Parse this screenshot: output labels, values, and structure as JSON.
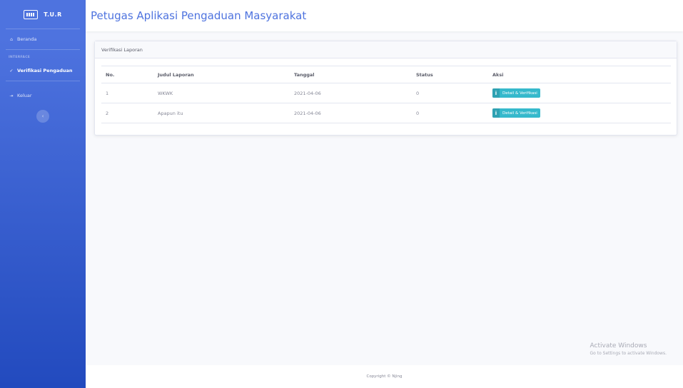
{
  "brand": {
    "name": "T.U.R",
    "icon": "keyboard-icon"
  },
  "sidebar": {
    "items": [
      {
        "label": "Beranda",
        "icon": "home-icon"
      }
    ],
    "heading": "INTERFACE",
    "interface_items": [
      {
        "label": "Verifikasi Pengaduan",
        "icon": "check-icon"
      }
    ],
    "logout": {
      "label": "Keluar",
      "icon": "logout-icon"
    },
    "toggle_icon": "chevron-left-icon"
  },
  "header": {
    "title": "Petugas Aplikasi Pengaduan Masyarakat"
  },
  "card": {
    "title": "Verifikasi Laporan",
    "columns": [
      "No.",
      "Judul Laporan",
      "Tanggal",
      "Status",
      "Aksi"
    ],
    "rows": [
      {
        "no": "1",
        "judul": "WKWK",
        "tanggal": "2021-04-06",
        "status": "0",
        "aksi": "Detail & Verifikasi"
      },
      {
        "no": "2",
        "judul": "Apapun itu",
        "tanggal": "2021-04-06",
        "status": "0",
        "aksi": "Detail & Verifikasi"
      }
    ]
  },
  "watermark": {
    "title": "Activate Windows",
    "subtitle": "Go to Settings to activate Windows."
  },
  "footer": {
    "copyright": "Copyright © Njing"
  },
  "colors": {
    "primary": "#4e73df",
    "info": "#36b9cc"
  }
}
